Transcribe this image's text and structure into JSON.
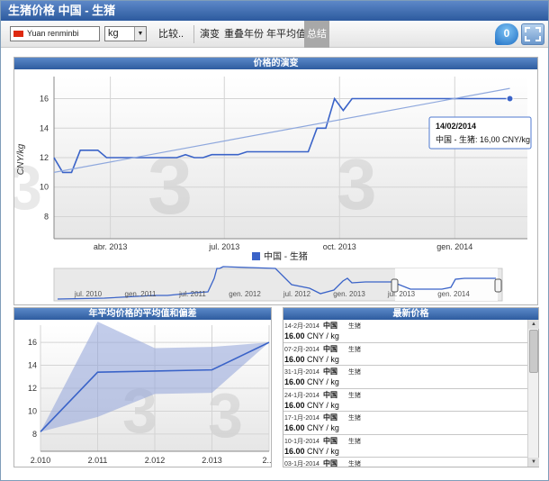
{
  "window": {
    "title": "生猪价格 中国 - 生猪"
  },
  "toolbar": {
    "currency": "Yuan renminbi",
    "unit": "kg",
    "compare": "比较..",
    "tabs": [
      "演变",
      "重叠年份",
      "年平均值",
      "总结"
    ],
    "active_tab": "总结",
    "chat_count": "0",
    "colors": {
      "title_bar": "#2c5a9e",
      "active_tab": "#a8a8a8",
      "line": "#3a63c8",
      "trend": "#8fa8dd"
    }
  },
  "evolution": {
    "title": "价格的演变",
    "ylabel": "CNY/kg",
    "legend": "中国 - 生猪",
    "tooltip": {
      "date": "14/02/2014",
      "text": "中国 - 生猪: 16,00 CNY/kg"
    },
    "navigator_labels": [
      "jul. 2010",
      "gen. 2011",
      "jul. 2011",
      "gen. 2012",
      "jul. 2012",
      "gen. 2013",
      "jul. 2013",
      "gen. 2014"
    ]
  },
  "average": {
    "title": "年平均价格的平均值和偏差"
  },
  "latest": {
    "title": "最新价格",
    "rows": [
      {
        "date": "14-2月-2014",
        "country": "中国",
        "product": "生猪",
        "value": "16.00",
        "unit": "CNY / kg"
      },
      {
        "date": "07-2月-2014",
        "country": "中国",
        "product": "生猪",
        "value": "16.00",
        "unit": "CNY / kg"
      },
      {
        "date": "31-1月-2014",
        "country": "中国",
        "product": "生猪",
        "value": "16.00",
        "unit": "CNY / kg"
      },
      {
        "date": "24-1月-2014",
        "country": "中国",
        "product": "生猪",
        "value": "16.00",
        "unit": "CNY / kg"
      },
      {
        "date": "17-1月-2014",
        "country": "中国",
        "product": "生猪",
        "value": "16.00",
        "unit": "CNY / kg"
      },
      {
        "date": "10-1月-2014",
        "country": "中国",
        "product": "生猪",
        "value": "16.00",
        "unit": "CNY / kg"
      },
      {
        "date": "03-1月-2014",
        "country": "中国",
        "product": "生猪",
        "value": "",
        "unit": ""
      }
    ]
  },
  "chart_data": [
    {
      "type": "line",
      "title": "价格的演变",
      "ylabel": "CNY/kg",
      "ylim": [
        6.5,
        17.5
      ],
      "yticks": [
        8,
        10,
        12,
        14,
        16
      ],
      "xticks": [
        {
          "label": "abr. 2013",
          "date": "2013-04-01"
        },
        {
          "label": "jul. 2013",
          "date": "2013-07-01"
        },
        {
          "label": "oct. 2013",
          "date": "2013-10-01"
        },
        {
          "label": "gen. 2014",
          "date": "2014-01-01"
        }
      ],
      "xlim": [
        "2013-02-15",
        "2014-02-28"
      ],
      "grid": true,
      "legend": "bottom",
      "series": [
        {
          "name": "中国 - 生猪",
          "points": [
            [
              "2013-02-15",
              12.0
            ],
            [
              "2013-02-22",
              11.0
            ],
            [
              "2013-03-01",
              11.0
            ],
            [
              "2013-03-08",
              12.5
            ],
            [
              "2013-03-15",
              12.5
            ],
            [
              "2013-03-22",
              12.5
            ],
            [
              "2013-03-29",
              12.0
            ],
            [
              "2013-04-05",
              12.0
            ],
            [
              "2013-04-26",
              12.0
            ],
            [
              "2013-05-17",
              12.0
            ],
            [
              "2013-05-24",
              12.0
            ],
            [
              "2013-05-31",
              12.2
            ],
            [
              "2013-06-07",
              12.0
            ],
            [
              "2013-06-14",
              12.0
            ],
            [
              "2013-06-21",
              12.2
            ],
            [
              "2013-06-28",
              12.2
            ],
            [
              "2013-07-05",
              12.2
            ],
            [
              "2013-07-12",
              12.2
            ],
            [
              "2013-07-19",
              12.4
            ],
            [
              "2013-08-02",
              12.4
            ],
            [
              "2013-08-23",
              12.4
            ],
            [
              "2013-09-06",
              12.4
            ],
            [
              "2013-09-13",
              14.0
            ],
            [
              "2013-09-20",
              14.0
            ],
            [
              "2013-09-27",
              16.0
            ],
            [
              "2013-10-04",
              15.2
            ],
            [
              "2013-10-11",
              16.0
            ],
            [
              "2013-11-01",
              16.0
            ],
            [
              "2013-12-06",
              16.0
            ],
            [
              "2014-01-03",
              16.0
            ],
            [
              "2014-02-14",
              16.0
            ]
          ]
        },
        {
          "name": "",
          "trend": true,
          "points": [
            [
              "2013-02-15",
              11.0
            ],
            [
              "2014-02-14",
              16.7
            ]
          ]
        }
      ],
      "tooltip": {
        "date": "14/02/2014",
        "value": 16.0,
        "text": "中国 - 生猪: 16,00 CNY/kg"
      }
    },
    {
      "type": "area",
      "title": "年平均价格的平均值和偏差",
      "x": [
        "2.010",
        "2.011",
        "2.012",
        "2.013",
        "2...."
      ],
      "ylim": [
        6.5,
        17.5
      ],
      "yticks": [
        8,
        10,
        12,
        14,
        16
      ],
      "series": [
        {
          "name": "",
          "role": "mean",
          "values": [
            8.2,
            13.4,
            13.5,
            13.6,
            16.0
          ]
        },
        {
          "name": "",
          "role": "upper",
          "values": [
            8.2,
            17.8,
            15.5,
            15.6,
            16.0
          ]
        },
        {
          "name": "",
          "role": "lower",
          "values": [
            8.2,
            9.5,
            11.5,
            11.6,
            16.0
          ]
        }
      ]
    }
  ]
}
